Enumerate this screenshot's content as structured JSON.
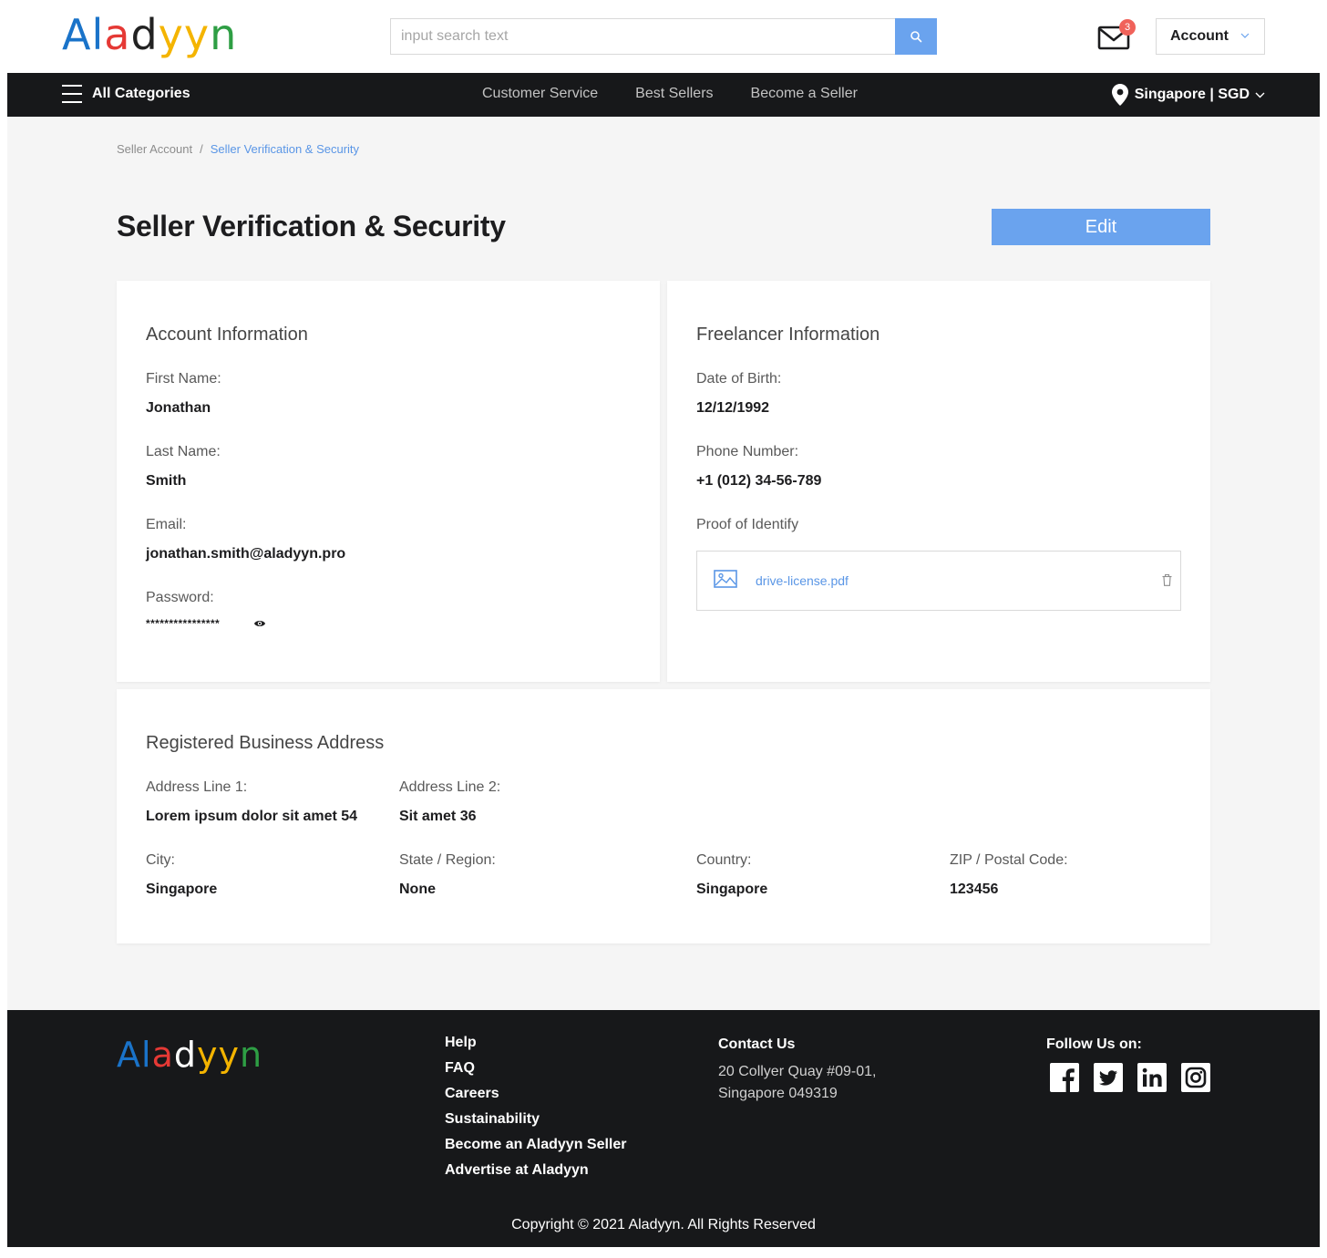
{
  "header": {
    "logo_letters": [
      "A",
      "l",
      "a",
      "d",
      "y",
      "y",
      "n"
    ],
    "logo_colors": [
      "#1a73c9",
      "#1a73c9",
      "#e53935",
      "#222222",
      "#f4b400",
      "#f4b400",
      "#2e9e44"
    ],
    "search_placeholder": "input search text",
    "mail_badge_count": "3",
    "account_label": "Account"
  },
  "nav": {
    "all_categories": "All Categories",
    "links": [
      "Customer Service",
      "Best Sellers",
      "Become a Seller"
    ],
    "region": "Singapore | SGD"
  },
  "breadcrumb": {
    "parent": "Seller Account",
    "separator": "/",
    "current": "Seller Verification & Security"
  },
  "page": {
    "title": "Seller Verification & Security",
    "edit_label": "Edit"
  },
  "account_info": {
    "title": "Account Information",
    "first_name_label": "First Name:",
    "first_name": "Jonathan",
    "last_name_label": "Last Name:",
    "last_name": "Smith",
    "email_label": "Email:",
    "email": "jonathan.smith@aladyyn.pro",
    "password_label": "Password:",
    "password_mask": "****************"
  },
  "freelancer_info": {
    "title": "Freelancer Information",
    "dob_label": "Date of Birth:",
    "dob": "12/12/1992",
    "phone_label": "Phone Number:",
    "phone": "+1 (012) 34-56-789",
    "proof_label": "Proof of Identify",
    "file_name": "drive-license.pdf"
  },
  "address": {
    "title": "Registered Business Address",
    "line1_label": "Address Line 1:",
    "line1": "Lorem ipsum dolor sit amet 54",
    "line2_label": "Address Line 2:",
    "line2": "Sit amet 36",
    "city_label": "City:",
    "city": "Singapore",
    "state_label": "State / Region:",
    "state": "None",
    "country_label": "Country:",
    "country": "Singapore",
    "zip_label": "ZIP / Postal Code:",
    "zip": "123456"
  },
  "footer": {
    "links": [
      "Help",
      "FAQ",
      "Careers",
      "Sustainability",
      "Become an Aladyyn Seller",
      "Advertise at Aladyyn"
    ],
    "contact_title": "Contact Us",
    "address_line1": "20 Collyer Quay #09-01,",
    "address_line2": "Singapore 049319",
    "follow_title": "Follow Us on:",
    "social_icons": [
      "facebook-icon",
      "twitter-icon",
      "linkedin-icon",
      "instagram-icon"
    ],
    "copyright": "Copyright © 2021 Aladyyn. All Rights Reserved"
  },
  "colors": {
    "accent": "#6aa3ee",
    "link": "#5a96e6",
    "nav_bg": "#17181a",
    "badge": "#f0625a"
  }
}
